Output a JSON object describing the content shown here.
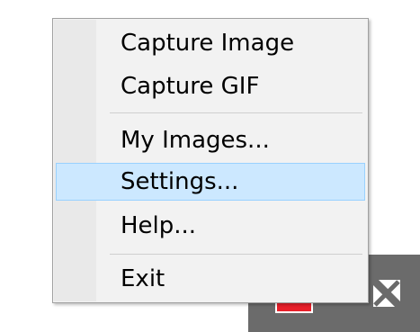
{
  "menu": {
    "items": [
      {
        "label": "Capture Image"
      },
      {
        "label": "Capture GIF"
      },
      {
        "label": "My Images..."
      },
      {
        "label": "Settings...",
        "highlighted": true
      },
      {
        "label": "Help..."
      },
      {
        "label": "Exit"
      }
    ]
  },
  "colors": {
    "highlight_bg": "#cce8ff",
    "highlight_border": "#99d1ff",
    "menu_bg": "#f2f2f2",
    "taskbar": "#6b6b6b"
  },
  "taskbar": {
    "icons": [
      "app-tray-icon",
      "arrow-icon"
    ]
  }
}
